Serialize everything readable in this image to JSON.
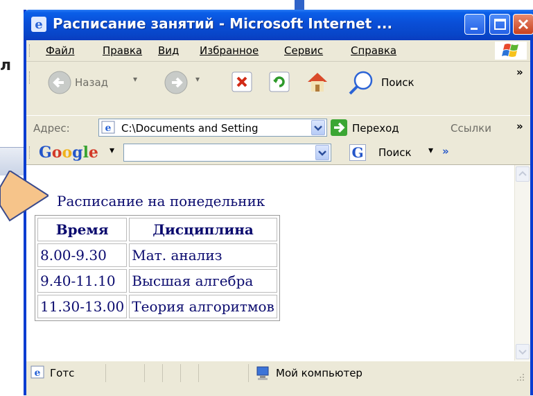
{
  "window": {
    "title": "Расписание занятий - Microsoft Internet ..."
  },
  "menu": {
    "items": [
      "Файл",
      "Правка",
      "Вид",
      "Избранное",
      "Сервис",
      "Справка"
    ]
  },
  "toolbar": {
    "back_label": "Назад",
    "search_label": "Поиск",
    "overflow": "»"
  },
  "address": {
    "label": "Адрес:",
    "value": "C:\\Documents and Setting",
    "go_label": "Переход",
    "links_label": "Ссылки",
    "overflow": "»"
  },
  "google": {
    "logo": "Google",
    "search_label": "Поиск",
    "overflow": "»"
  },
  "page": {
    "heading": "Расписание на понедельник",
    "table": {
      "headers": [
        "Время",
        "Дисциплина"
      ],
      "rows": [
        [
          "8.00-9.30",
          "Мат. анализ"
        ],
        [
          "9.40-11.10",
          "Высшая алгебра"
        ],
        [
          "11.30-13.00",
          "Теория алгоритмов"
        ]
      ]
    }
  },
  "status": {
    "text": "Готс",
    "zone": "Мой компьютер"
  },
  "background": {
    "letter": "л"
  },
  "colors": {
    "titlebar": "#0a4ed6",
    "link_text": "#0a0a6e",
    "arrow_fill": "#f6c48a",
    "arrow_stroke": "#3a4a8c"
  }
}
